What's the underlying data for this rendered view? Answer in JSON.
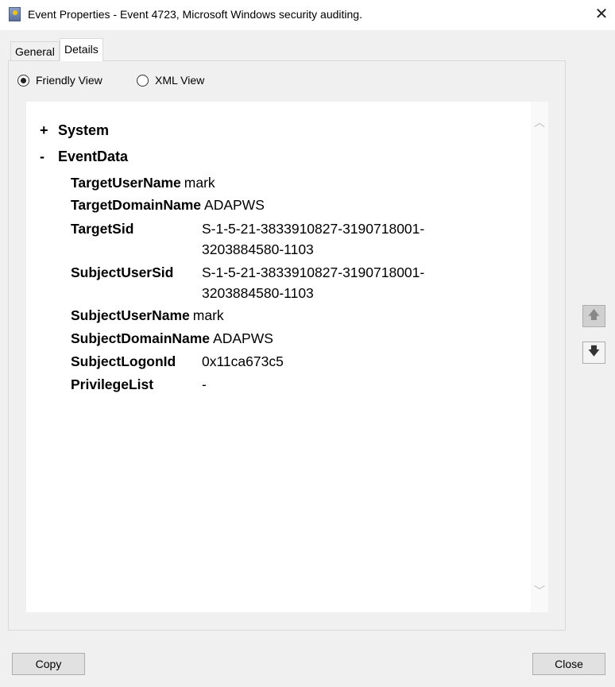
{
  "window": {
    "title": "Event Properties - Event 4723, Microsoft Windows security auditing.",
    "icon": "event-viewer-icon"
  },
  "tabs": [
    {
      "label": "General",
      "selected": false
    },
    {
      "label": "Details",
      "selected": true
    }
  ],
  "view_options": [
    {
      "label": "Friendly View",
      "selected": true
    },
    {
      "label": "XML View",
      "selected": false
    }
  ],
  "tree": {
    "system": {
      "sign": "+",
      "label": "System"
    },
    "eventdata": {
      "sign": "-",
      "label": "EventData"
    },
    "fields": [
      {
        "key": "TargetUserName",
        "value": "mark"
      },
      {
        "key": "TargetDomainName",
        "value": "ADAPWS"
      },
      {
        "key": "TargetSid",
        "value": "S-1-5-21-3833910827-3190718001-3203884580-1103"
      },
      {
        "key": "SubjectUserSid",
        "value": "S-1-5-21-3833910827-3190718001-3203884580-1103"
      },
      {
        "key": "SubjectUserName",
        "value": "mark"
      },
      {
        "key": "SubjectDomainName",
        "value": "ADAPWS"
      },
      {
        "key": "SubjectLogonId",
        "value": "0x11ca673c5"
      },
      {
        "key": "PrivilegeList",
        "value": "-"
      }
    ]
  },
  "buttons": {
    "copy": "Copy",
    "close": "Close"
  }
}
